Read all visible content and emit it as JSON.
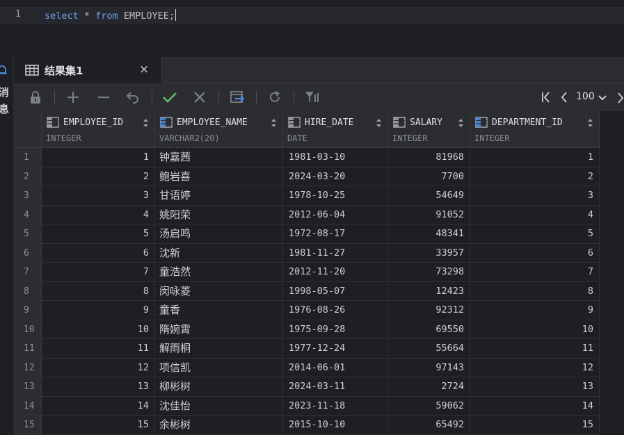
{
  "editor": {
    "line_number": "1",
    "kw_select": "select",
    "star": " * ",
    "kw_from": "from",
    "table": " EMPLOYEE;"
  },
  "side": {
    "label1": "消",
    "label2": "息"
  },
  "tab": {
    "label": "结果集1",
    "close": "×"
  },
  "toolbar": {
    "page_size": "100"
  },
  "grid": {
    "columns": [
      {
        "name": "EMPLOYEE_ID",
        "type": "INTEGER"
      },
      {
        "name": "EMPLOYEE_NAME",
        "type": "VARCHAR2(20)"
      },
      {
        "name": "HIRE_DATE",
        "type": "DATE"
      },
      {
        "name": "SALARY",
        "type": "INTEGER"
      },
      {
        "name": "DEPARTMENT_ID",
        "type": "INTEGER"
      }
    ],
    "rows": [
      [
        "1",
        "1",
        "钟嘉茜",
        "1981-03-10",
        "81968",
        "1"
      ],
      [
        "2",
        "2",
        "鲍岩喜",
        "2024-03-20",
        "7700",
        "2"
      ],
      [
        "3",
        "3",
        "甘语婷",
        "1978-10-25",
        "54649",
        "3"
      ],
      [
        "4",
        "4",
        "姚阳荣",
        "2012-06-04",
        "91052",
        "4"
      ],
      [
        "5",
        "5",
        "汤启鸣",
        "1972-08-17",
        "48341",
        "5"
      ],
      [
        "6",
        "6",
        "沈新",
        "1981-11-27",
        "33957",
        "6"
      ],
      [
        "7",
        "7",
        "童浩然",
        "2012-11-20",
        "73298",
        "7"
      ],
      [
        "8",
        "8",
        "闵咏菱",
        "1998-05-07",
        "12423",
        "8"
      ],
      [
        "9",
        "9",
        "童香",
        "1976-08-26",
        "92312",
        "9"
      ],
      [
        "10",
        "10",
        "隋婉霄",
        "1975-09-28",
        "69550",
        "10"
      ],
      [
        "11",
        "11",
        "解雨桐",
        "1977-12-24",
        "55664",
        "11"
      ],
      [
        "12",
        "12",
        "项信凯",
        "2014-06-01",
        "97143",
        "12"
      ],
      [
        "13",
        "13",
        "柳彬树",
        "2024-03-11",
        "2724",
        "13"
      ],
      [
        "14",
        "14",
        "沈佳怡",
        "2023-11-18",
        "59062",
        "14"
      ],
      [
        "15",
        "15",
        "余彬树",
        "2015-10-10",
        "65492",
        "15"
      ]
    ]
  },
  "colors": {
    "bg": "#1e1f22",
    "panel": "#2b2d30",
    "keyword": "#6fa0e6",
    "check": "#5fb865"
  }
}
